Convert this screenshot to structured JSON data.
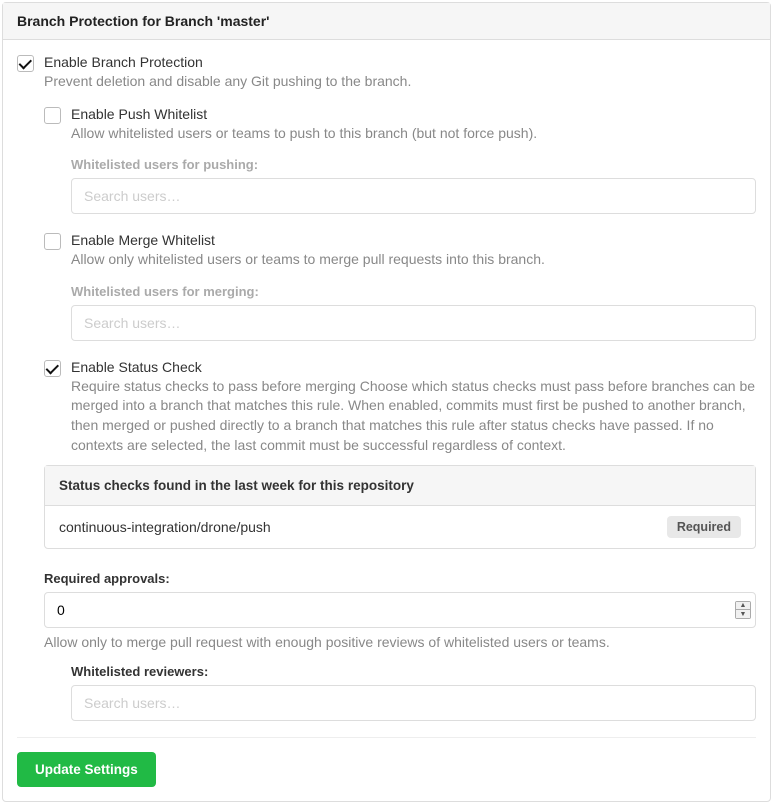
{
  "header": {
    "title": "Branch Protection for Branch 'master'"
  },
  "enableBranchProtection": {
    "checked": true,
    "label": "Enable Branch Protection",
    "desc": "Prevent deletion and disable any Git pushing to the branch."
  },
  "enablePushWhitelist": {
    "checked": false,
    "label": "Enable Push Whitelist",
    "desc": "Allow whitelisted users or teams to push to this branch (but not force push).",
    "subLabel": "Whitelisted users for pushing:",
    "placeholder": "Search users…"
  },
  "enableMergeWhitelist": {
    "checked": false,
    "label": "Enable Merge Whitelist",
    "desc": "Allow only whitelisted users or teams to merge pull requests into this branch.",
    "subLabel": "Whitelisted users for merging:",
    "placeholder": "Search users…"
  },
  "enableStatusCheck": {
    "checked": true,
    "label": "Enable Status Check",
    "desc": "Require status checks to pass before merging Choose which status checks must pass before branches can be merged into a branch that matches this rule. When enabled, commits must first be pushed to another branch, then merged or pushed directly to a branch that matches this rule after status checks have passed. If no contexts are selected, the last commit must be successful regardless of context."
  },
  "statusChecks": {
    "header": "Status checks found in the last week for this repository",
    "items": [
      {
        "name": "continuous-integration/drone/push",
        "badge": "Required"
      }
    ]
  },
  "requiredApprovals": {
    "label": "Required approvals:",
    "value": "0",
    "desc": "Allow only to merge pull request with enough positive reviews of whitelisted users or teams."
  },
  "whitelistedReviewers": {
    "label": "Whitelisted reviewers:",
    "placeholder": "Search users…"
  },
  "actions": {
    "submit": "Update Settings"
  }
}
